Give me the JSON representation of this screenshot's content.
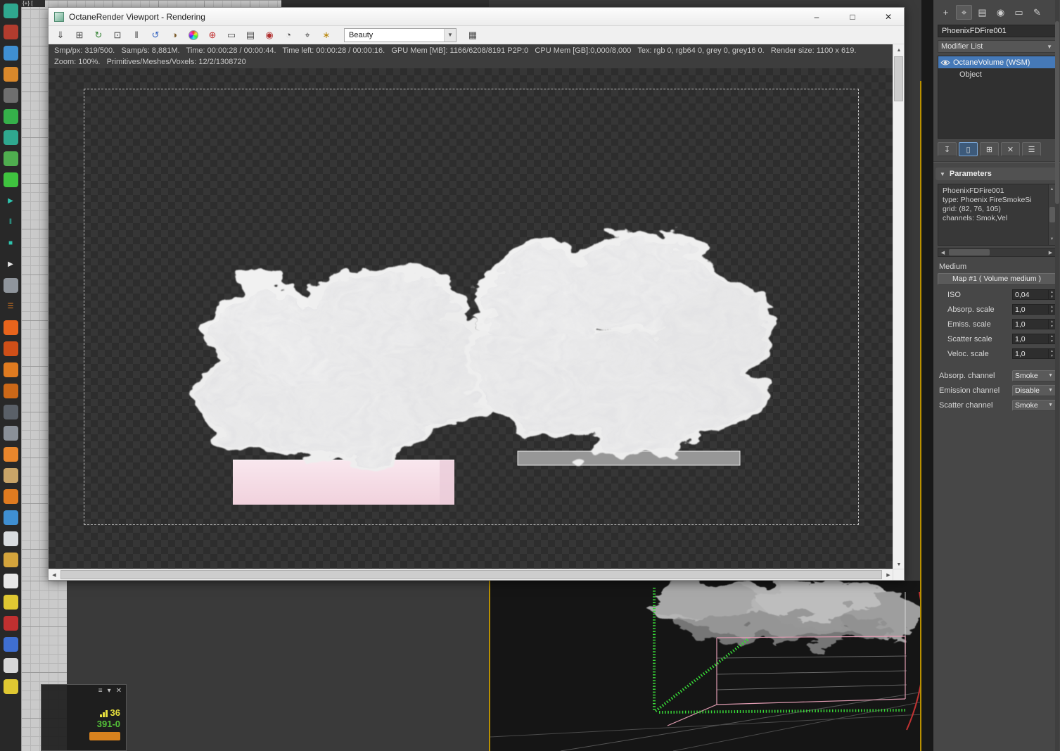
{
  "viewport_label": "{+} [",
  "colors": {
    "selection_blue": "#4579b8",
    "active_viewport_border": "#b99000",
    "stats_yellow": "#e6df3e",
    "stats_green": "#55c43a",
    "pink_box": "#f5dce6"
  },
  "octane_window": {
    "title": "OctaneRender Viewport - Rendering",
    "controls": {
      "minimize": "–",
      "maximize": "□",
      "close": "✕"
    },
    "toolbar": {
      "icons": [
        {
          "name": "save-image-icon",
          "glyph": "⇓",
          "fg": "#4a4a4a"
        },
        {
          "name": "copy-image-icon",
          "glyph": "⊞",
          "fg": "#4a4a4a"
        },
        {
          "name": "restart-render-icon",
          "glyph": "↻",
          "fg": "#2f7f2f"
        },
        {
          "name": "lock-resolution-icon",
          "glyph": "⊡",
          "fg": "#4a4a4a"
        },
        {
          "name": "pause-render-icon",
          "glyph": "‖",
          "fg": "#4a4a4a"
        },
        {
          "name": "refresh-render-icon",
          "glyph": "↺",
          "fg": "#2f5fbf"
        },
        {
          "name": "clay-mode-icon",
          "glyph": "◑",
          "fg": "#7a5a2a"
        },
        {
          "name": "color-wheel-icon"
        },
        {
          "name": "stop-render-icon",
          "glyph": "⊕",
          "fg": "#c03030"
        },
        {
          "name": "display-mode-icon",
          "glyph": "▭",
          "fg": "#4a4a4a"
        },
        {
          "name": "film-settings-icon",
          "glyph": "▤",
          "fg": "#4a4a4a"
        },
        {
          "name": "record-icon",
          "glyph": "◉",
          "fg": "#b03030"
        },
        {
          "name": "camera-icon",
          "glyph": "◔",
          "fg": "#4a4a4a"
        },
        {
          "name": "material-picker-icon",
          "glyph": "⌖",
          "fg": "#4a4a4a"
        },
        {
          "name": "render-priority-icon",
          "glyph": "∗",
          "fg": "#b8860b"
        }
      ],
      "render_pass_value": "Beauty",
      "post_icon": {
        "name": "pixel-grid-icon",
        "glyph": "▦",
        "fg": "#4a4a4a"
      }
    },
    "status_line1": "Smp/px: 319/500.   Samp/s: 8,881M.   Time: 00:00:28 / 00:00:44.   Time left: 00:00:28 / 00:00:16.   GPU Mem [MB]: 1166/6208/8191 P2P:0   CPU Mem [GB]:0,000/8,000   Tex: rgb 0, rgb64 0, grey 0, grey16 0.   Render size: 1100 x 619.",
    "status_line2": "Zoom: 100%.   Primitives/Meshes/Voxels: 12/2/1308720"
  },
  "left_toolbar": {
    "icons": [
      {
        "name": "phoenix-sim-icon",
        "color": "#2fa88f"
      },
      {
        "name": "character-icon",
        "color": "#b23c2e"
      },
      {
        "name": "liquid-source-icon",
        "color": "#3f8fd2"
      },
      {
        "name": "particle-group-icon",
        "color": "#d9882b"
      },
      {
        "name": "ring-icon",
        "color": "#6f6f6f"
      },
      {
        "name": "move-gizmo-icon",
        "color": "#35b04a"
      },
      {
        "name": "export-arrow-icon",
        "color": "#2fa88f"
      },
      {
        "name": "checker-map-icon",
        "color": "#4fae4f"
      },
      {
        "name": "snowflake-icon",
        "color": "#3fc43f"
      },
      {
        "name": "play-icon",
        "glyph": "▶",
        "fg": "#2fc4ae"
      },
      {
        "name": "pause-icon",
        "glyph": "‖",
        "fg": "#2fc4ae"
      },
      {
        "name": "stop-icon",
        "glyph": "■",
        "fg": "#2fc4ae"
      },
      {
        "name": "preview-play-icon",
        "glyph": "▶",
        "fg": "#e6e6e6"
      },
      {
        "name": "trash-icon",
        "color": "#8f959c"
      },
      {
        "name": "log-list-icon",
        "glyph": "☰",
        "fg": "#e07b20"
      },
      {
        "name": "fire-preset-icon",
        "color": "#e8641c"
      },
      {
        "name": "fire-box-icon",
        "color": "#cf4f18"
      },
      {
        "name": "smoke-preset-icon",
        "color": "#e07b20"
      },
      {
        "name": "flame-preset-icon",
        "color": "#cc6818"
      },
      {
        "name": "gear-preset-icon",
        "color": "#5a6068"
      },
      {
        "name": "vortex-icon",
        "color": "#8a9098"
      },
      {
        "name": "droplet-flame-icon",
        "color": "#e8862c"
      },
      {
        "name": "barrel-icon",
        "color": "#c8a468"
      },
      {
        "name": "tool-magnet-icon",
        "color": "#e07b20"
      },
      {
        "name": "water-drop-icon",
        "color": "#3f8fd2"
      },
      {
        "name": "sail-icon",
        "color": "#d8dce0"
      },
      {
        "name": "beer-mug-icon",
        "color": "#d4a43c"
      },
      {
        "name": "cup-icon",
        "color": "#e8e8e8"
      },
      {
        "name": "duck-icon",
        "color": "#e0c832"
      },
      {
        "name": "splat-icon",
        "color": "#c03030"
      },
      {
        "name": "blue-ball-icon",
        "color": "#3f6fd2"
      },
      {
        "name": "white-ball-icon",
        "color": "#d8d8d8"
      },
      {
        "name": "smiley-icon",
        "color": "#e0c832"
      }
    ]
  },
  "command_panel": {
    "tabs": [
      {
        "name": "tab-create",
        "glyph": "+"
      },
      {
        "name": "tab-modify",
        "glyph": "⌖"
      },
      {
        "name": "tab-hierarchy",
        "glyph": "▤"
      },
      {
        "name": "tab-motion",
        "glyph": "◉"
      },
      {
        "name": "tab-display",
        "glyph": "▭"
      },
      {
        "name": "tab-utilities",
        "glyph": "✎"
      }
    ],
    "object_name": "PhoenixFDFire001",
    "modifier_list_label": "Modifier List",
    "stack": [
      {
        "label": "OctaneVolume (WSM)"
      },
      {
        "label": "Object"
      }
    ],
    "stack_buttons": [
      {
        "name": "pin-stack-button",
        "glyph": "↧"
      },
      {
        "name": "show-end-result-button",
        "glyph": "▯"
      },
      {
        "name": "make-unique-button",
        "glyph": "⊞"
      },
      {
        "name": "remove-modifier-button",
        "glyph": "✕"
      },
      {
        "name": "configure-modifier-sets-button",
        "glyph": "☰"
      }
    ],
    "rollout_title": "Parameters",
    "info_lines": [
      "PhoenixFDFire001",
      "type: Phoenix FireSmokeSi",
      "grid: (82, 76, 105)",
      "channels: Smok,Vel"
    ],
    "medium_label": "Medium",
    "map_button_label": "Map #1 ( Volume medium )",
    "spinners": [
      {
        "label": "ISO",
        "value": "0,04"
      },
      {
        "label": "Absorp. scale",
        "value": "1,0"
      },
      {
        "label": "Emiss. scale",
        "value": "1,0"
      },
      {
        "label": "Scatter scale",
        "value": "1,0"
      },
      {
        "label": "Veloc. scale",
        "value": "1,0"
      }
    ],
    "channels": [
      {
        "label": "Absorp. channel",
        "value": "Smoke"
      },
      {
        "label": "Emission channel",
        "value": "Disable"
      },
      {
        "label": "Scatter channel",
        "value": "Smoke"
      }
    ]
  },
  "stats_window": {
    "controls": [
      "≡",
      "▾",
      "✕"
    ],
    "rows": [
      {
        "value": "36",
        "color": "#e6df3e"
      },
      {
        "value": "391-0",
        "color": "#55c43a"
      }
    ]
  }
}
